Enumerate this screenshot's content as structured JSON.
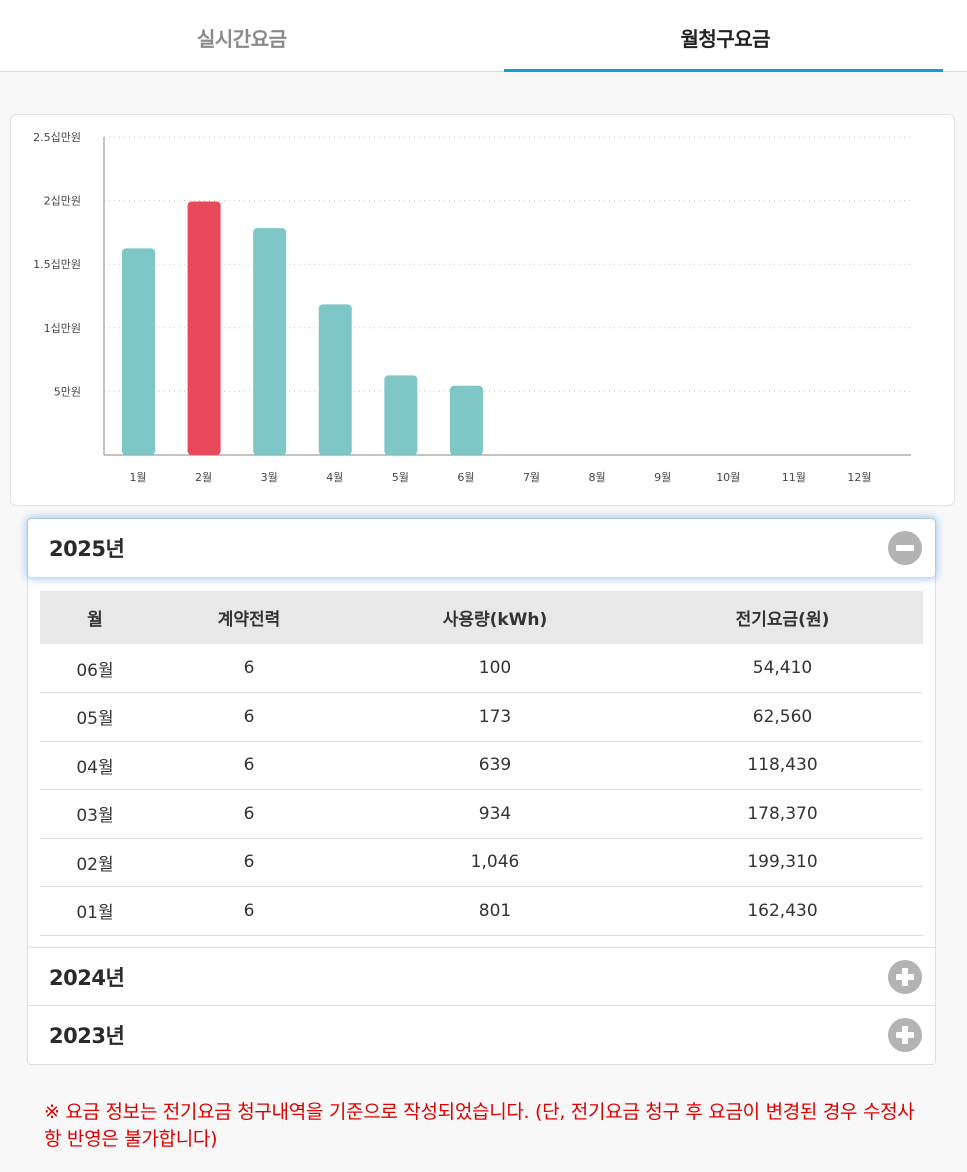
{
  "tabs": {
    "realtime": "실시간요금",
    "monthly": "월청구요금"
  },
  "chart_data": {
    "type": "bar",
    "categories": [
      "1월",
      "2월",
      "3월",
      "4월",
      "5월",
      "6월",
      "7월",
      "8월",
      "9월",
      "10월",
      "11월",
      "12월"
    ],
    "values": [
      162430,
      199310,
      178370,
      118430,
      62560,
      54410,
      null,
      null,
      null,
      null,
      null,
      null
    ],
    "highlight_index": 1,
    "colors": {
      "normal": "#7ec7c6",
      "highlight": "#e84a5c"
    },
    "ylim": [
      0,
      250000
    ],
    "yticks": [
      {
        "value": 50000,
        "label": "5만원"
      },
      {
        "value": 100000,
        "label": "1십만원"
      },
      {
        "value": 150000,
        "label": "1.5십만원"
      },
      {
        "value": 200000,
        "label": "2십만원"
      },
      {
        "value": 250000,
        "label": "2.5십만원"
      }
    ],
    "grid": true
  },
  "years": {
    "y2025": "2025년",
    "y2024": "2024년",
    "y2023": "2023년"
  },
  "table": {
    "headers": [
      "월",
      "계약전력",
      "사용량(kWh)",
      "전기요금(원)"
    ],
    "rows": [
      [
        "06월",
        "6",
        "100",
        "54,410"
      ],
      [
        "05월",
        "6",
        "173",
        "62,560"
      ],
      [
        "04월",
        "6",
        "639",
        "118,430"
      ],
      [
        "03월",
        "6",
        "934",
        "178,370"
      ],
      [
        "02월",
        "6",
        "1,046",
        "199,310"
      ],
      [
        "01월",
        "6",
        "801",
        "162,430"
      ]
    ]
  },
  "icons": {
    "collapse": "minus-circle-icon",
    "expand": "plus-circle-icon"
  },
  "notice": "※ 요금 정보는 전기요금 청구내역을 기준으로 작성되었습니다. (단, 전기요금 청구 후 요금이 변경된 경우 수정사항 반영은 불가합니다)"
}
